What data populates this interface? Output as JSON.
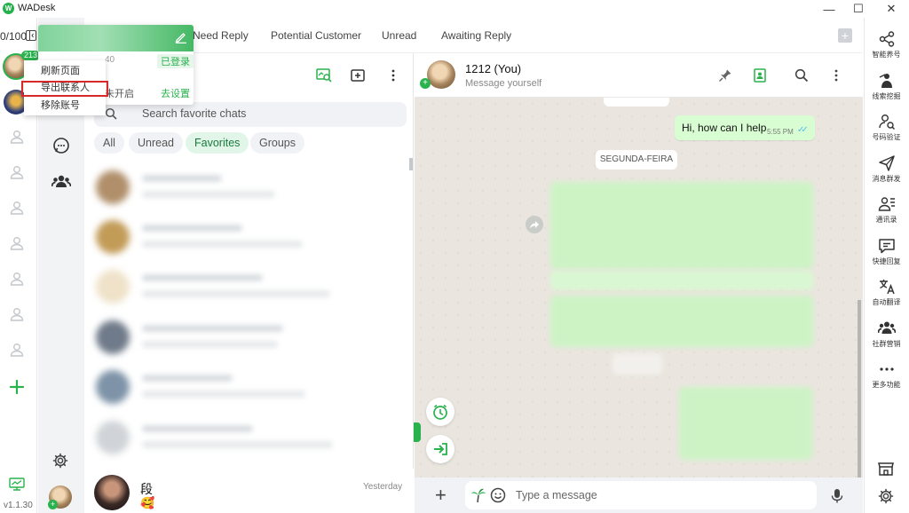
{
  "app": {
    "title": "WADesk",
    "logo_letter": "W",
    "version": "v1.1.30"
  },
  "window": {
    "minimize": "—",
    "maximize": "☐",
    "close": "✕"
  },
  "accounts": {
    "count": "0/100",
    "badge": "213"
  },
  "top_tabs": [
    "Need Reply",
    "Potential Customer",
    "Unread",
    "Awaiting Reply"
  ],
  "add_tab": "+",
  "account_card": {
    "id_fragment": "40",
    "logged_in": "已登录",
    "not_open_fragment": "未开启",
    "go_settings": "去设置"
  },
  "context_menu": {
    "items": [
      "刷新页面",
      "导出联系人",
      "移除账号"
    ],
    "highlighted": "导出联系人"
  },
  "chat_list": {
    "search_placeholder": "Search favorite chats",
    "filters": [
      "All",
      "Unread",
      "Favorites",
      "Groups"
    ],
    "active_filter": "Favorites",
    "last_chat": {
      "name": "段",
      "preview": "🥰",
      "time": "Yesterday"
    }
  },
  "conversation": {
    "name": "1212 (You)",
    "subtitle": "Message yourself",
    "messages": [
      {
        "direction": "out",
        "text": "Hi, how can I help",
        "time": "5:55 PM",
        "ticks": "✓✓"
      }
    ],
    "day_divider": "SEGUNDA-FEIRA",
    "composer_placeholder": "Type a message",
    "composer_plus": "+"
  },
  "tools": [
    {
      "label": "智能养号",
      "icon": "share-nodes-icon"
    },
    {
      "label": "线索挖掘",
      "icon": "miner-icon"
    },
    {
      "label": "号码验证",
      "icon": "user-search-icon"
    },
    {
      "label": "消息群发",
      "icon": "send-icon"
    },
    {
      "label": "通讯录",
      "icon": "contacts-icon"
    },
    {
      "label": "快捷回复",
      "icon": "quick-reply-icon"
    },
    {
      "label": "自动翻译",
      "icon": "translate-icon"
    },
    {
      "label": "社群营销",
      "icon": "community-icon"
    },
    {
      "label": "更多功能",
      "icon": "more-icon"
    }
  ],
  "colors": {
    "brand_green": "#29b24d",
    "chat_bg": "#eae6df",
    "out_bubble": "#d9fdd3",
    "highlight_red": "#d62a2a"
  }
}
